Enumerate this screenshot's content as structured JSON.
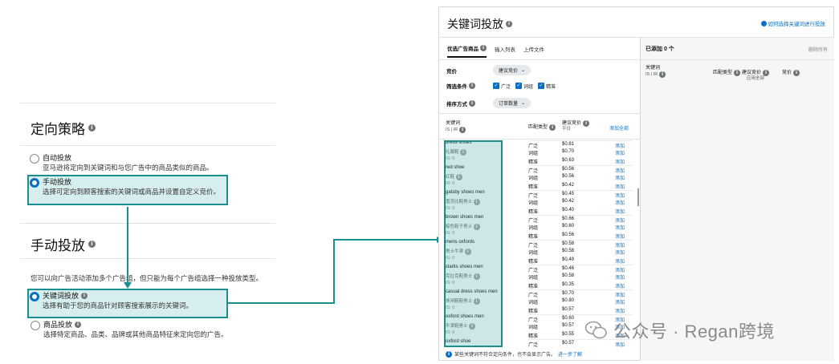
{
  "strategy_panel": {
    "title": "定向策略",
    "auto": {
      "label": "自动投放",
      "desc": "亚马逊将定向到关键词和与您广告中的商品类似的商品。"
    },
    "manual": {
      "label": "手动投放",
      "desc": "选择可定向到顾客搜索的关键词或商品并设置自定义竞价。"
    }
  },
  "manual_panel": {
    "title": "手动投放",
    "intro": "您可以向广告活动添加多个广告组，但只能为每个广告组选择一种投放类型。",
    "keyword": {
      "label": "关键词投放",
      "desc": "选择有助于您的商品针对顾客搜索展示的关键词。"
    },
    "product": {
      "label": "商品投放",
      "desc": "选择特定商品、品类、品牌或其他商品特征来定向您的广告。"
    }
  },
  "modal": {
    "title": "关键词投放",
    "help_link": "如何选择关键词进行投放",
    "tabs": [
      "优选广告商品",
      "输入列表",
      "上传文件"
    ],
    "bid_label": "竞价",
    "bid_value": "建议竞价",
    "filter_label": "筛选条件",
    "filter_options": [
      "广泛",
      "词组",
      "精准"
    ],
    "sort_label": "排序方式",
    "sort_value": "订单数量",
    "header": {
      "keyword": "关键词",
      "keyword_sub": "IS | IR",
      "match": "匹配类型",
      "suggested": "建议竞价",
      "suggested_sub": "平日",
      "add_all": "添加全部"
    },
    "keywords": [
      {
        "name": "dress shoes",
        "translation": "礼服鞋",
        "is": "IS: 0",
        "rows": [
          [
            "广泛",
            "$0.81",
            "添加"
          ],
          [
            "词组",
            "$0.70",
            "添加"
          ],
          [
            "精准",
            "$0.63",
            "添加"
          ]
        ]
      },
      {
        "name": "red shoe",
        "translation": "红鞋",
        "is": "IS: 0",
        "rows": [
          [
            "广泛",
            "$0.56",
            "添加"
          ],
          [
            "词组",
            "$0.56",
            "添加"
          ],
          [
            "精准",
            "$0.42",
            "添加"
          ]
        ]
      },
      {
        "name": "gatsby shoes men",
        "translation": "盖茨比鞋男士",
        "is": "IS: 0",
        "rows": [
          [
            "广泛",
            "$0.45",
            "添加"
          ],
          [
            "词组",
            "$0.42",
            "添加"
          ],
          [
            "精准",
            "$0.40",
            "添加"
          ]
        ]
      },
      {
        "name": "brown shoes men",
        "translation": "棕色鞋子男士",
        "is": "IS: 0",
        "rows": [
          [
            "广泛",
            "$0.66",
            "添加"
          ],
          [
            "词组",
            "$0.60",
            "添加"
          ],
          [
            "精准",
            "$0.56",
            "添加"
          ]
        ]
      },
      {
        "name": "mens oxfords",
        "translation": "男士牛津",
        "is": "IS: 0",
        "rows": [
          [
            "广泛",
            "$0.58",
            "添加"
          ],
          [
            "词组",
            "$0.58",
            "添加"
          ],
          [
            "精准",
            "$0.49",
            "添加"
          ]
        ]
      },
      {
        "name": "clarks shoes men",
        "translation": "克拉克鞋男士",
        "is": "IS: 0",
        "rows": [
          [
            "广泛",
            "$0.46",
            "添加"
          ],
          [
            "词组",
            "$0.58",
            "添加"
          ],
          [
            "精准",
            "$0.35",
            "添加"
          ]
        ]
      },
      {
        "name": "casual dress shoes men",
        "translation": "休闲鞋鞋男士",
        "is": "IS: 0",
        "rows": [
          [
            "广泛",
            "$0.70",
            "添加"
          ],
          [
            "词组",
            "$0.80",
            "添加"
          ],
          [
            "精准",
            "$0.57",
            "添加"
          ]
        ]
      },
      {
        "name": "oxford shoes men",
        "translation": "牛津鞋男士",
        "is": "IS: 0",
        "rows": [
          [
            "广泛",
            "$0.60",
            "添加"
          ],
          [
            "词组",
            "$0.57",
            "添加"
          ],
          [
            "精准",
            "$0.55",
            "添加"
          ]
        ]
      },
      {
        "name": "oxford shoe",
        "translation": "",
        "is": "",
        "rows": [
          [
            "广泛",
            "$0.57",
            "添加"
          ]
        ]
      }
    ],
    "footer_note": "某些关键词不符合定向条件，也不会显示广告。",
    "footer_link": "进一步了解",
    "right": {
      "added": "已添加 0 个",
      "remove_all": "删除所有",
      "col_keyword": "关键词",
      "col_keyword_sub": "IS | IR",
      "col_match": "匹配类型",
      "col_suggested": "建议竞价",
      "col_suggested_sub": "应用全部",
      "col_bid": "竞价"
    }
  },
  "watermark": "公众号 · Regan跨境",
  "colors": {
    "teal": "#1b8f8f",
    "link": "#0a6fc2"
  }
}
